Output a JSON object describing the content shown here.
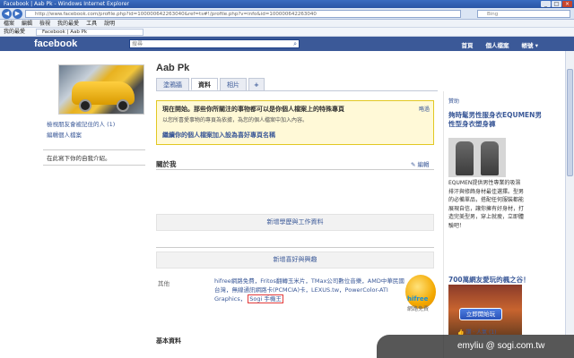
{
  "window": {
    "title": "Facebook | Aab Pk - Windows Internet Explorer",
    "buttons": [
      "_",
      "□",
      "×"
    ]
  },
  "address": {
    "url": "http://www.facebook.com/profile.php?id=100000642263040&ref=ts#!/profile.php?v=info&id=100000642263040",
    "search_placeholder": "Bing"
  },
  "menu": [
    "檔案",
    "編輯",
    "檢視",
    "我的最愛",
    "工具",
    "說明"
  ],
  "favorites": {
    "label": "我的最愛",
    "tab": "Facebook | Aab Pk"
  },
  "fb": {
    "logo": "facebook",
    "search_placeholder": "搜尋",
    "nav": [
      "首頁",
      "個人檔案",
      "帳號 ▾"
    ]
  },
  "profile": {
    "name": "Aab Pk",
    "tabs": [
      "塗鴉牆",
      "資料",
      "相片",
      "+"
    ],
    "left_links": [
      "檢視朋友會被記住的人 (1)",
      "編輯個人檔案"
    ],
    "left_box": "在此寫下你的自我介紹。"
  },
  "getstarted": {
    "heading": "現在開始。那些你所關注的事物都可以是你個人檔案上的特殊專頁",
    "sub": "以您所喜愛事物的專頁為依據，為您的個人檔案中加入內容。",
    "link": "繼續你的個人檔案加入設為喜好專頁名稱",
    "close": "略過"
  },
  "sections": {
    "about": "關於我",
    "edit": "✎ 編輯",
    "add_edu": "新增學歷與工作資料",
    "add_likes": "新增喜好與興趣",
    "other_label": "其他",
    "other_text_a": "hifree網路免費，Fritos翻轉玉米片，TMax公司數位音樂，AMD中華民國台灣，無線通訊網路卡(PCMCIA)卡，LEXUS.tw，PowerColor-ATI Graphics，",
    "other_text_hl": "Sogi 手機王",
    "hifree_label": "hifree",
    "hifree_sub": "網路免費",
    "bottom": "基本資料"
  },
  "ads": {
    "head": "贊助",
    "ad1_title": "夠時髦男性服身衣EQUMEN男性型身衣塑身褲",
    "ad1_body": "EQUMEN提供男性專業的吸濕排汗與修飾身材最佳選擇。型男的必備單品，搭配任何服裝都能展現自信，讓你擁有好身材，打造完美型男，穿上就瘦，立即體驗吧！",
    "ad2_title": "700萬網友愛玩的楓之谷！",
    "ad2_btn": "立即開始玩",
    "ad2_like": "👍 讚 · 人氣 (1)"
  },
  "watermark": "emyliu @ sogi.com.tw"
}
